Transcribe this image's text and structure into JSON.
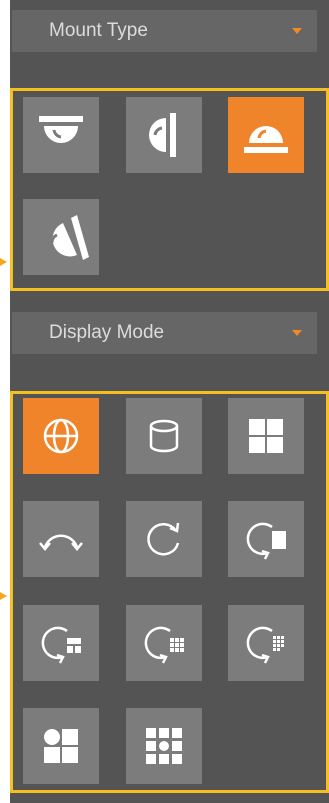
{
  "mount_type": {
    "label": "Mount Type",
    "options": [
      {
        "icon": "ceiling-mount-icon",
        "selected": false
      },
      {
        "icon": "wall-mount-icon",
        "selected": false
      },
      {
        "icon": "desktop-mount-icon",
        "selected": true
      },
      {
        "icon": "slant-mount-icon",
        "selected": false
      }
    ]
  },
  "display_mode": {
    "label": "Display Mode",
    "options": [
      {
        "icon": "fisheye-globe-icon",
        "selected": true
      },
      {
        "icon": "panorama-cylinder-icon",
        "selected": false
      },
      {
        "icon": "quad-view-icon",
        "selected": false
      },
      {
        "icon": "panorama-180-icon",
        "selected": false
      },
      {
        "icon": "panorama-360-icon",
        "selected": false
      },
      {
        "icon": "fisheye-plus-1-icon",
        "selected": false
      },
      {
        "icon": "fisheye-plus-3-icon",
        "selected": false
      },
      {
        "icon": "fisheye-plus-8-icon",
        "selected": false
      },
      {
        "icon": "fisheye-plus-8-alt-icon",
        "selected": false
      },
      {
        "icon": "multi-view-icon",
        "selected": false
      },
      {
        "icon": "grid-view-icon",
        "selected": false
      }
    ]
  },
  "colors": {
    "panel": "#545454",
    "tile": "#7c7c7c",
    "selected": "#f0842a",
    "frame": "#f5bf1d",
    "dropdown": "#666666"
  }
}
